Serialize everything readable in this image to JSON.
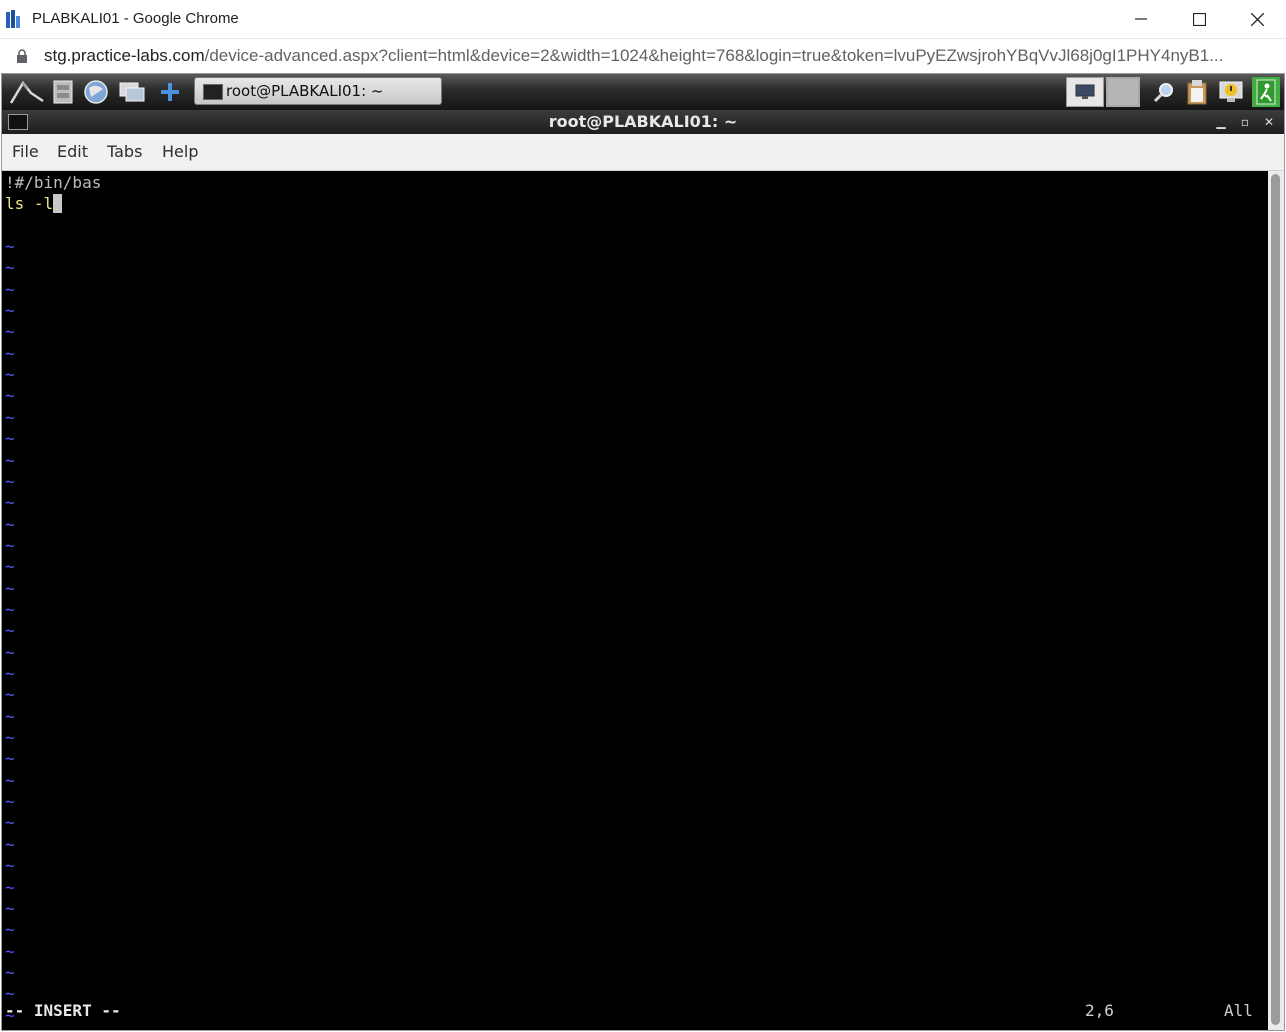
{
  "browser": {
    "title": "PLABKALI01 - Google Chrome",
    "url_host": "stg.practice-labs.com",
    "url_path": "/device-advanced.aspx?client=html&device=2&width=1024&height=768&login=true&token=lvuPyEZwsjrohYBqVvJl68j0gI1PHY4nyB1..."
  },
  "panel": {
    "task_label": "root@PLABKALI01: ~",
    "launchers": [
      "kali-dragon-icon",
      "file-manager-icon",
      "web-browser-icon",
      "show-desktop-icon",
      "add-launcher-icon"
    ],
    "tray": [
      "display-icon",
      "workspace-switcher-icon",
      "search-icon",
      "clipboard-icon",
      "notification-icon",
      "logout-icon"
    ]
  },
  "terminal": {
    "title": "root@PLABKALI01: ~",
    "menu": [
      "File",
      "Edit",
      "Tabs",
      "Help"
    ],
    "lines": [
      "!#/bin/bas",
      "ls -l"
    ],
    "tilde": "~",
    "mode": "-- INSERT --",
    "position": "2,6",
    "scroll_pos": "All"
  },
  "colors": {
    "terminal_bg": "#000000",
    "text_line1": "#bcbcbc",
    "text_line2": "#f0e68c",
    "tilde": "#5555ff"
  }
}
